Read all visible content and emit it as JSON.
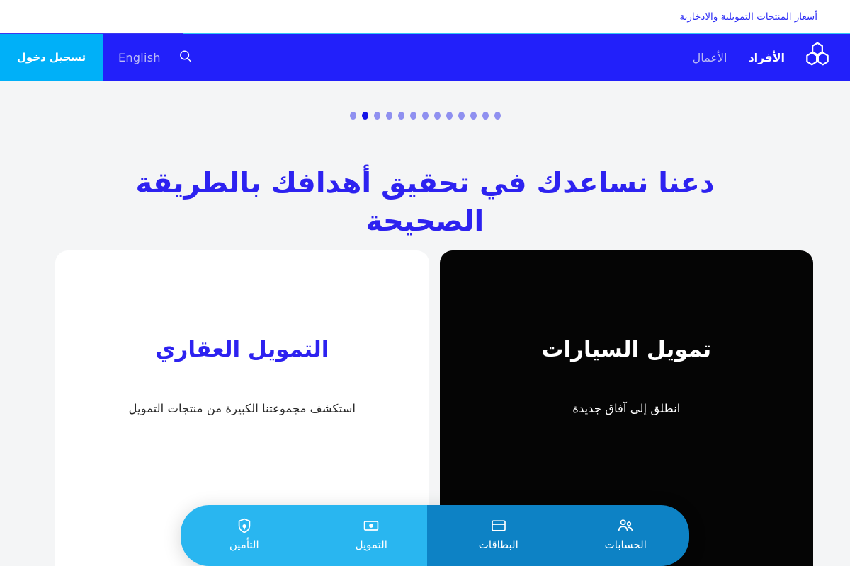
{
  "topbar": {
    "link_label": "أسعار المنتجات التمويلية والادخارية"
  },
  "navbar": {
    "login_label": "تسجيل دخول",
    "language_label": "English",
    "search_icon": "search-icon",
    "logo_icon": "alrajhi-trefoil-logo",
    "menu": [
      {
        "label": "الأفراد",
        "active": true
      },
      {
        "label": "الأعمال",
        "active": false
      }
    ]
  },
  "carousel": {
    "total_dots": 13,
    "active_index": 11
  },
  "hero": {
    "headline": "دعنا نساعدك في تحقيق أهدافك بالطريقة الصحيحة"
  },
  "cards": [
    {
      "theme": "dark",
      "title": "تمويل السيارات",
      "subtitle": "انطلق إلى آفاق جديدة"
    },
    {
      "theme": "light",
      "title": "التمويل العقاري",
      "subtitle": "استكشف مجموعتنا الكبيرة من منتجات التمويل"
    }
  ],
  "bottom_nav": {
    "items": [
      {
        "label": "الحسابات",
        "icon": "people-icon"
      },
      {
        "label": "البطاقات",
        "icon": "credit-card-icon"
      },
      {
        "label": "التمويل",
        "icon": "banknote-icon"
      },
      {
        "label": "التأمين",
        "icon": "shield-lock-icon"
      }
    ]
  },
  "colors": {
    "nav_blue": "#2220fa",
    "login_cyan": "#00b0f8",
    "headline_blue": "#2d22f0",
    "page_bg": "#f4f5f6",
    "bottom_nav_light": "#29b6f0",
    "bottom_nav_dark": "#0d82c5"
  }
}
